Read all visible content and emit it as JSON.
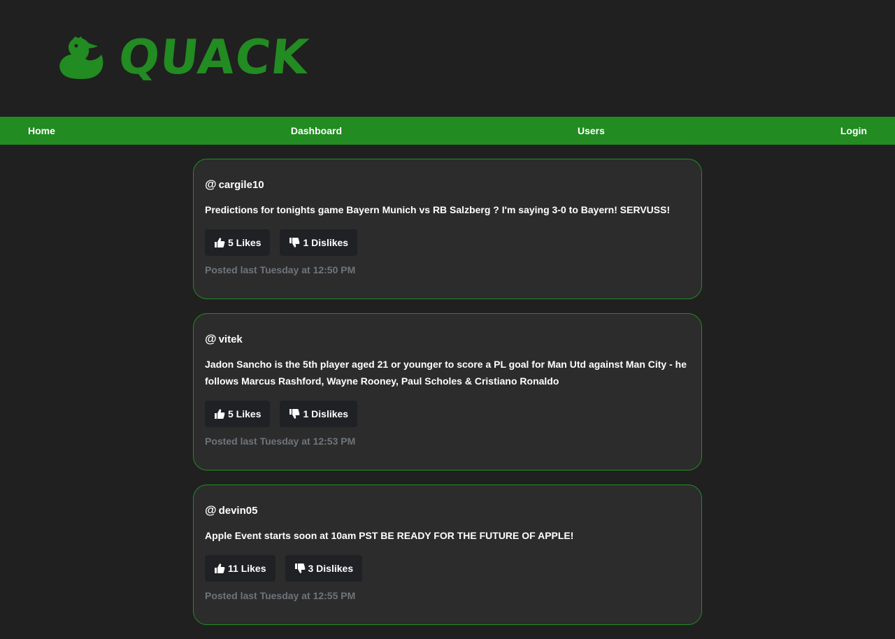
{
  "brand": {
    "name": "QUACK",
    "icon": "duck-icon",
    "color": "#228b22"
  },
  "nav": {
    "home": "Home",
    "dashboard": "Dashboard",
    "users": "Users",
    "login": "Login"
  },
  "posts": [
    {
      "at": "@",
      "username": "cargile10",
      "body": "Predictions for tonights game Bayern Munich vs RB Salzberg ? I'm saying 3-0 to Bayern! SERVUSS!",
      "likes": "5 Likes",
      "dislikes": "1 Dislikes",
      "timestamp": "Posted last Tuesday at 12:50 PM"
    },
    {
      "at": "@",
      "username": "vitek",
      "body": "Jadon Sancho is the 5th player aged 21 or younger to score a PL goal for Man Utd against Man City - he follows Marcus Rashford, Wayne Rooney, Paul Scholes & Cristiano Ronaldo",
      "likes": "5 Likes",
      "dislikes": "1 Dislikes",
      "timestamp": "Posted last Tuesday at 12:53 PM"
    },
    {
      "at": "@",
      "username": "devin05",
      "body": "Apple Event starts soon at 10am PST BE READY FOR THE FUTURE OF APPLE!",
      "likes": "11 Likes",
      "dislikes": "3 Dislikes",
      "timestamp": "Posted last Tuesday at 12:55 PM"
    }
  ],
  "colors": {
    "background": "#202020",
    "card": "#2c2c2c",
    "accent": "#228b22",
    "button": "#1f2124",
    "muted": "#6e757c"
  }
}
